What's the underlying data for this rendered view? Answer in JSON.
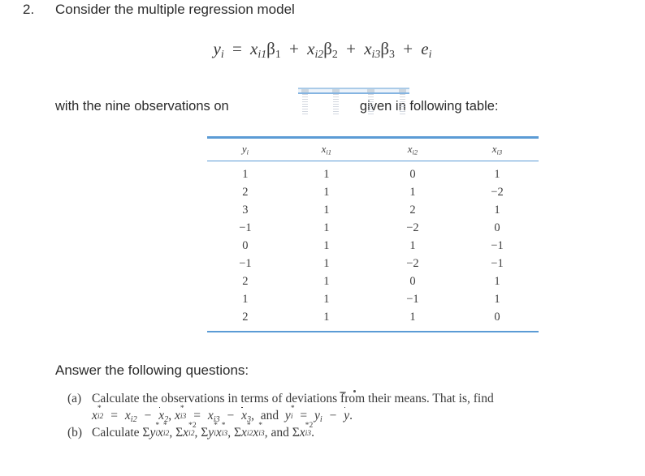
{
  "question": {
    "number": "2.",
    "title": "Consider the multiple regression model"
  },
  "equation": {
    "lhs_var": "y",
    "lhs_sub": "i",
    "equals": "=",
    "terms": [
      {
        "x": "x",
        "x_sub": "i1",
        "beta": "β",
        "beta_sub": "1"
      },
      {
        "x": "x",
        "x_sub": "i2",
        "beta": "β",
        "beta_sub": "2"
      },
      {
        "x": "x",
        "x_sub": "i3",
        "beta": "β",
        "beta_sub": "3"
      }
    ],
    "plus": "+",
    "error": "e",
    "error_sub": "i",
    "full_text": "yᵢ = xᵢ₁β₁ + xᵢ₂β₂ + xᵢ₃β₃ + eᵢ"
  },
  "observations_line": {
    "before": "with the nine observations on",
    "after": "given in following table:"
  },
  "table": {
    "headers": [
      {
        "var": "y",
        "sub": "i"
      },
      {
        "var": "x",
        "sub": "i1"
      },
      {
        "var": "x",
        "sub": "i2"
      },
      {
        "var": "x",
        "sub": "i3"
      }
    ],
    "rows": [
      [
        "1",
        "1",
        "0",
        "1"
      ],
      [
        "2",
        "1",
        "1",
        "−2"
      ],
      [
        "3",
        "1",
        "2",
        "1"
      ],
      [
        "−1",
        "1",
        "−2",
        "0"
      ],
      [
        "0",
        "1",
        "1",
        "−1"
      ],
      [
        "−1",
        "1",
        "−2",
        "−1"
      ],
      [
        "2",
        "1",
        "0",
        "1"
      ],
      [
        "1",
        "1",
        "−1",
        "1"
      ],
      [
        "2",
        "1",
        "1",
        "0"
      ]
    ],
    "rule_color": "#5b9bd5"
  },
  "answer_section": {
    "heading": "Answer the following questions:",
    "parts": [
      {
        "label": "(a)",
        "text": "Calculate the observations in terms of deviations from their means. That is, find",
        "formula": "x*ᵢ₂ = xᵢ₂ − x̅2, x*ᵢ₃ = xᵢ₃ − x̅3,  and y*ᵢ = yᵢ − ȳ."
      },
      {
        "label": "(b)",
        "text": "Calculate",
        "formula": "Σy*ᵢx*ᵢ₂, Σx*²ᵢ₂, Σy*ᵢx*ᵢ₃, Σx*ᵢ₂x*ᵢ₃, and Σx*²ᵢ₃.",
        "connector": "and"
      }
    ]
  }
}
